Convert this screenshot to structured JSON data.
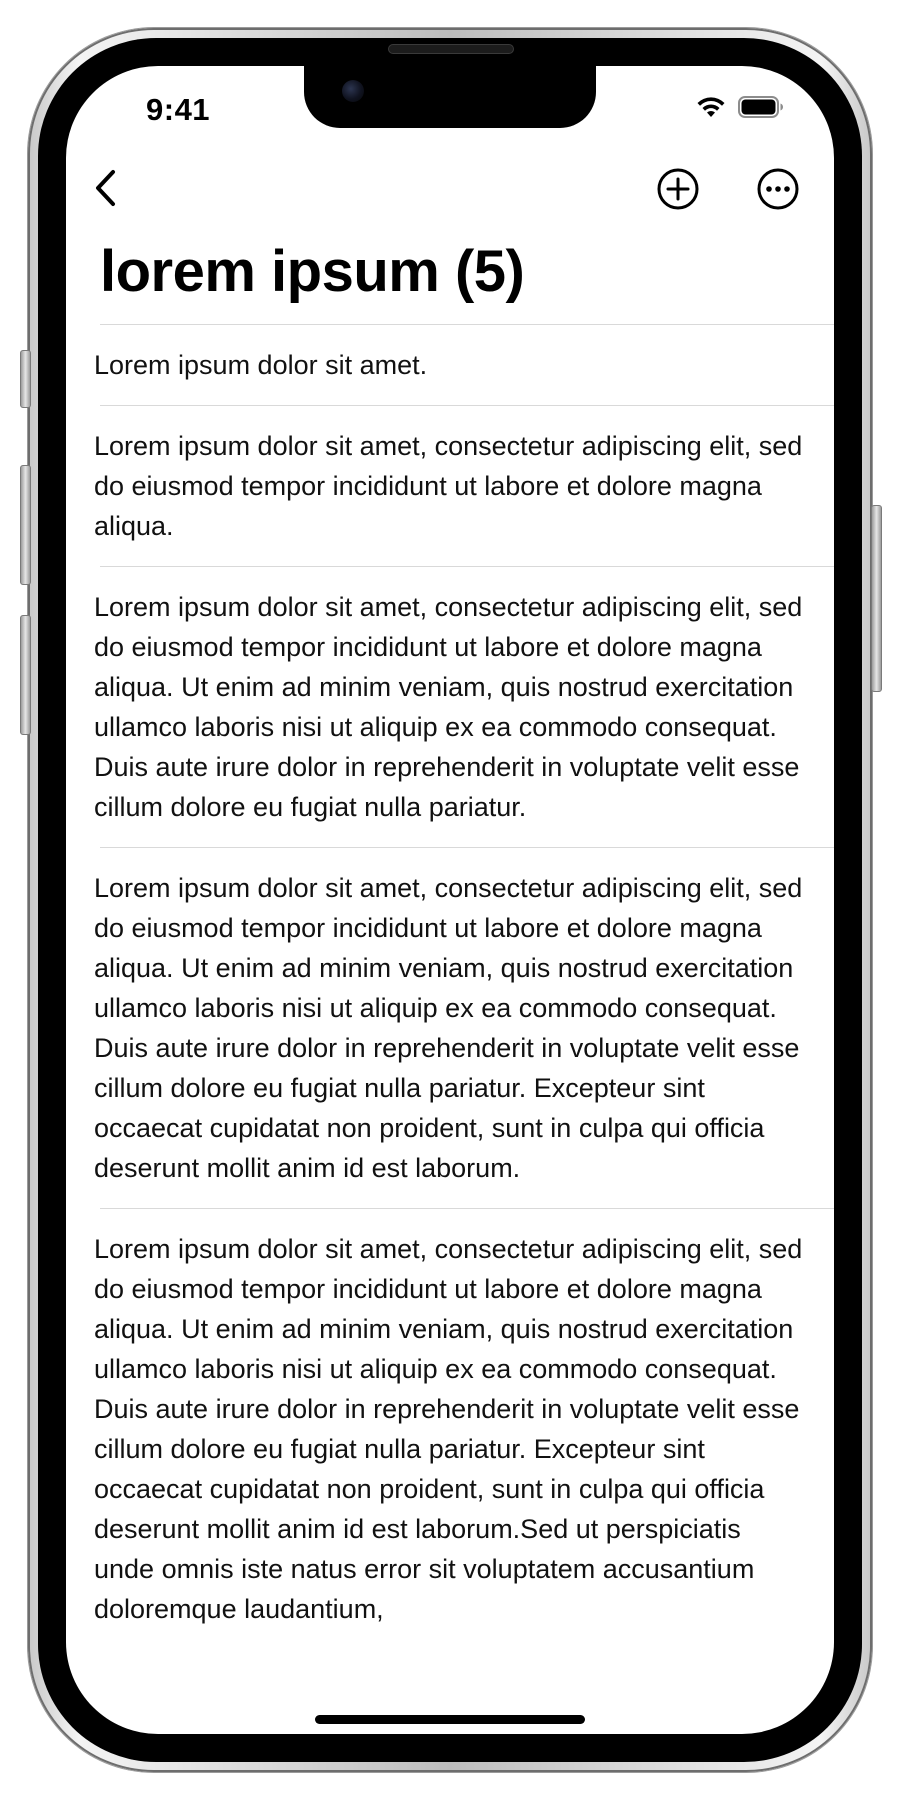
{
  "status_bar": {
    "time": "9:41",
    "icons": [
      "wifi-icon",
      "battery-icon"
    ]
  },
  "nav_bar": {
    "back_icon": "chevron-left-icon",
    "add_icon": "plus-circle-icon",
    "more_icon": "ellipsis-circle-icon"
  },
  "header": {
    "title": "lorem ipsum (5)"
  },
  "notes": [
    "Lorem ipsum dolor sit amet.",
    "Lorem ipsum dolor sit amet, consectetur adipiscing elit, sed do eiusmod tempor incididunt ut labore et dolore magna aliqua.",
    "Lorem ipsum dolor sit amet, consectetur adipiscing elit, sed do eiusmod tempor incididunt ut labore et dolore magna aliqua. Ut enim ad minim veniam, quis nostrud exercitation ullamco laboris nisi ut aliquip ex ea commodo consequat. Duis aute irure dolor in reprehenderit in voluptate velit esse cillum dolore eu fugiat nulla pariatur.",
    "Lorem ipsum dolor sit amet, consectetur adipiscing elit, sed do eiusmod tempor incididunt ut labore et dolore magna aliqua. Ut enim ad minim veniam, quis nostrud exercitation ullamco laboris nisi ut aliquip ex ea commodo consequat. Duis aute irure dolor in reprehenderit in voluptate velit esse cillum dolore eu fugiat nulla pariatur. Excepteur sint occaecat cupidatat non proident, sunt in culpa qui officia deserunt mollit anim id est laborum.",
    "Lorem ipsum dolor sit amet, consectetur adipiscing elit, sed do eiusmod tempor incididunt ut labore et dolore magna aliqua. Ut enim ad minim veniam, quis nostrud exercitation ullamco laboris nisi ut aliquip ex ea commodo consequat. Duis aute irure dolor in reprehenderit in voluptate velit esse cillum dolore eu fugiat nulla pariatur. Excepteur sint occaecat cupidatat non proident, sunt in culpa qui officia deserunt mollit anim id est laborum.Sed ut perspiciatis unde omnis iste natus error sit voluptatem accusantium doloremque laudantium,"
  ],
  "colors": {
    "text": "#111111",
    "separator": "#d9d9d9",
    "background": "#ffffff",
    "bezel": "#000000"
  }
}
